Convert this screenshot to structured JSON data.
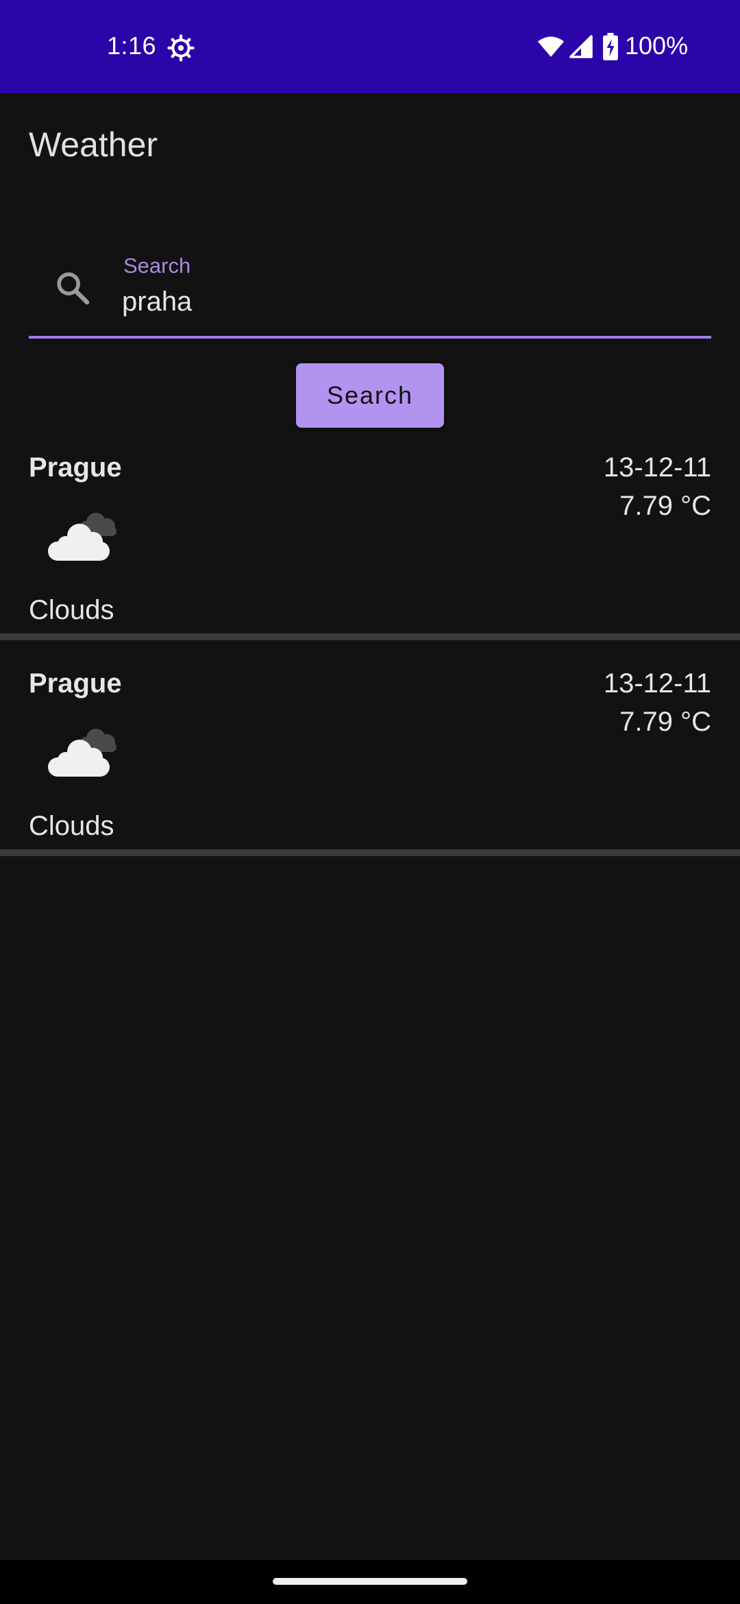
{
  "status_bar": {
    "time": "1:16",
    "battery": "100%",
    "icons": [
      "gear-icon",
      "wifi-icon",
      "signal-icon",
      "battery-icon"
    ],
    "background": "#2c05a8"
  },
  "app": {
    "title": "Weather"
  },
  "search": {
    "label": "Search",
    "value": "praha",
    "icon": "search-icon",
    "accent": "#9f7ce3"
  },
  "search_button": {
    "label": "Search",
    "color": "#b393f0"
  },
  "results": [
    {
      "city": "Prague",
      "date": "13-12-11",
      "temp": "7.79 °C",
      "condition": "Clouds",
      "icon": "clouds-icon"
    },
    {
      "city": "Prague",
      "date": "13-12-11",
      "temp": "7.79 °C",
      "condition": "Clouds",
      "icon": "clouds-icon"
    }
  ]
}
